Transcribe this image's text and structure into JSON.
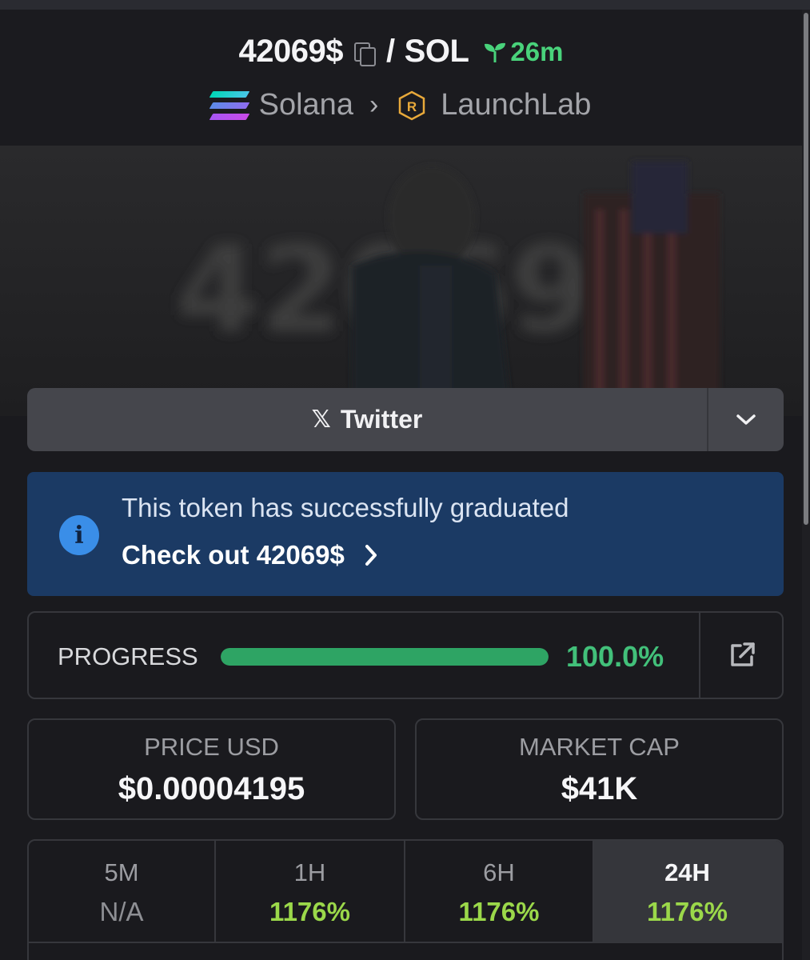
{
  "header": {
    "token_symbol": "42069$",
    "pair_sep": "/",
    "quote_symbol": "SOL",
    "age": "26m",
    "chain": "Solana",
    "dex": "LaunchLab"
  },
  "social": {
    "button_label": "Twitter"
  },
  "notice": {
    "message": "This token has successfully graduated",
    "link_text": "Check out 42069$"
  },
  "progress": {
    "label": "PROGRESS",
    "value_text": "100.0%",
    "fraction": 1.0
  },
  "stats": {
    "price_label": "PRICE USD",
    "price_value": "$0.00004195",
    "mcap_label": "MARKET CAP",
    "mcap_value": "$41K"
  },
  "timeframes": [
    {
      "label": "5M",
      "value": "N/A"
    },
    {
      "label": "1H",
      "value": "1176%"
    },
    {
      "label": "6H",
      "value": "1176%"
    },
    {
      "label": "24H",
      "value": "1176%"
    }
  ],
  "colors": {
    "positive": "#9bd84a",
    "progress_fill": "#2ea464",
    "info_bg": "#1b3a64",
    "age_green": "#49d37b"
  }
}
